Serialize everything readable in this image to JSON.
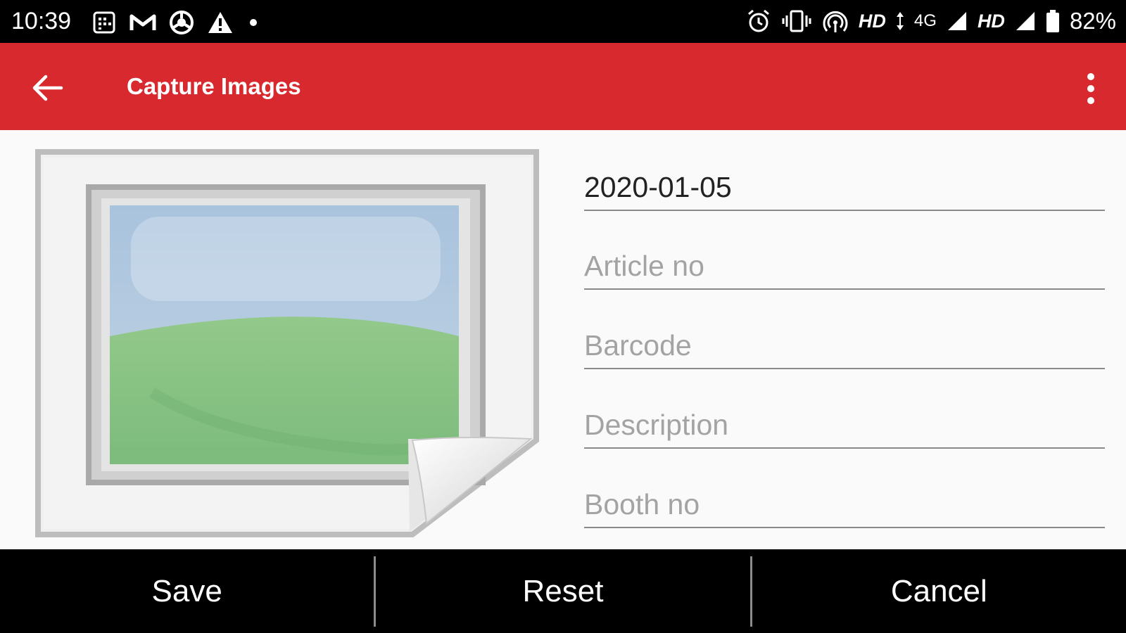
{
  "status_bar": {
    "time": "10:39",
    "left_icons": [
      "calendar-icon",
      "gmail-icon",
      "chrome-icon",
      "warning-icon",
      "dot-icon"
    ],
    "right_icons": [
      "alarm-icon",
      "vibrate-icon",
      "hotspot-icon",
      "signal-icon",
      "battery-icon"
    ],
    "network_1": "HD",
    "network_type": "4G",
    "network_2": "HD",
    "battery": "82%"
  },
  "app_bar": {
    "title": "Capture Images",
    "color": "#d82a2e"
  },
  "form": {
    "date_value": "2020-01-05",
    "article_placeholder": "Article no",
    "barcode_placeholder": "Barcode",
    "description_placeholder": "Description",
    "booth_placeholder": "Booth no"
  },
  "bottom_bar": {
    "save_label": "Save",
    "reset_label": "Reset",
    "cancel_label": "Cancel"
  }
}
